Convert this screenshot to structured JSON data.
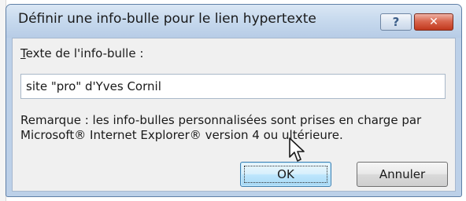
{
  "dialog": {
    "title": "Définir une info-bulle pour le lien hypertexte",
    "help_button": "?",
    "close_button": "✕"
  },
  "form": {
    "field_label": "Texte de l'info-bulle :",
    "field_value": "site \"pro\" d'Yves Cornil",
    "remark": "Remarque : les info-bulles personnalisées sont prises en charge par Microsoft® Internet Explorer® version 4 ou ultérieure."
  },
  "buttons": {
    "ok_label": "OK",
    "cancel_label": "Annuler"
  },
  "colors": {
    "frame": "#bcd0e8",
    "client": "#f0f0f0",
    "close": "#c1381d",
    "ok_focus": "#3c7fb1"
  },
  "icons": {
    "help": "question-icon",
    "close": "close-icon",
    "cursor": "mouse-pointer-icon"
  }
}
